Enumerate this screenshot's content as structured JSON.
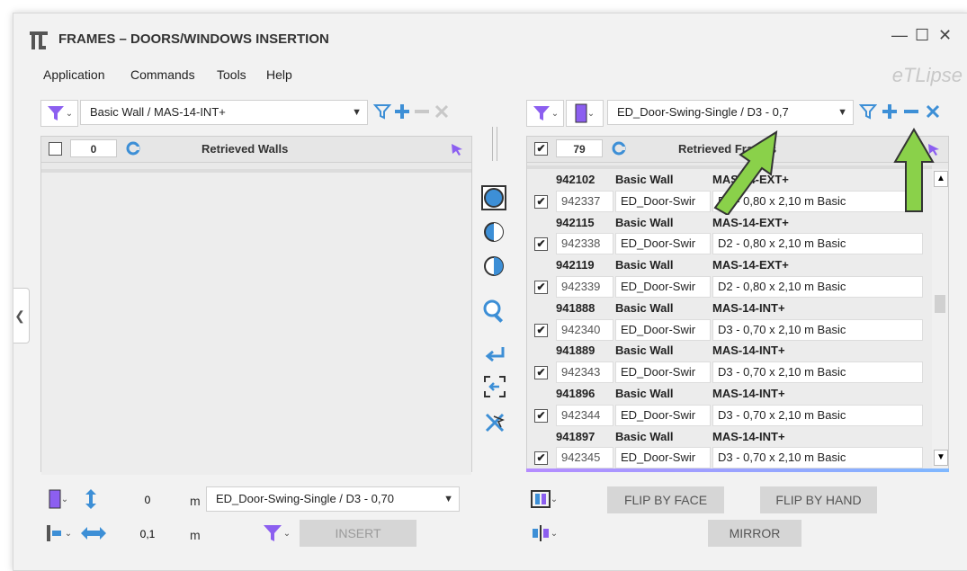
{
  "window": {
    "title": "FRAMES – DOORS/WINDOWS INSERTION",
    "logo": "eTLipse"
  },
  "menu": {
    "items": [
      "Application",
      "Commands",
      "Tools",
      "Help"
    ]
  },
  "left": {
    "filter_combo": "Basic Wall / MAS-14-INT+",
    "count": "0",
    "header": "Retrieved Walls"
  },
  "right": {
    "filter_combo": "ED_Door-Swing-Single / D3 - 0,7",
    "count": "79",
    "header": "Retrieved Frames",
    "rows": [
      {
        "type": "wall",
        "id": "942102",
        "family": "Basic Wall",
        "type_name": "MAS-14-EXT+"
      },
      {
        "type": "door",
        "checked": true,
        "id": "942337",
        "family": "ED_Door-Swir",
        "type_name": "D2 - 0,80 x 2,10 m Basic"
      },
      {
        "type": "wall",
        "id": "942115",
        "family": "Basic Wall",
        "type_name": "MAS-14-EXT+"
      },
      {
        "type": "door",
        "checked": true,
        "id": "942338",
        "family": "ED_Door-Swir",
        "type_name": "D2 - 0,80 x 2,10 m Basic"
      },
      {
        "type": "wall",
        "id": "942119",
        "family": "Basic Wall",
        "type_name": "MAS-14-EXT+"
      },
      {
        "type": "door",
        "checked": true,
        "id": "942339",
        "family": "ED_Door-Swir",
        "type_name": "D2 - 0,80 x 2,10 m Basic"
      },
      {
        "type": "wall",
        "id": "941888",
        "family": "Basic Wall",
        "type_name": "MAS-14-INT+"
      },
      {
        "type": "door",
        "checked": true,
        "id": "942340",
        "family": "ED_Door-Swir",
        "type_name": "D3 - 0,70 x 2,10 m Basic"
      },
      {
        "type": "wall",
        "id": "941889",
        "family": "Basic Wall",
        "type_name": "MAS-14-INT+"
      },
      {
        "type": "door",
        "checked": true,
        "id": "942343",
        "family": "ED_Door-Swir",
        "type_name": "D3 - 0,70 x 2,10 m Basic"
      },
      {
        "type": "wall",
        "id": "941896",
        "family": "Basic Wall",
        "type_name": "MAS-14-INT+"
      },
      {
        "type": "door",
        "checked": true,
        "id": "942344",
        "family": "ED_Door-Swir",
        "type_name": "D3 - 0,70 x 2,10 m Basic"
      },
      {
        "type": "wall",
        "id": "941897",
        "family": "Basic Wall",
        "type_name": "MAS-14-INT+"
      },
      {
        "type": "door",
        "checked": true,
        "id": "942345",
        "family": "ED_Door-Swir",
        "type_name": "D3 - 0,70 x 2,10 m Basic"
      }
    ]
  },
  "bottom_left": {
    "offset_value": "0",
    "offset_unit": "m",
    "type_combo": "ED_Door-Swing-Single / D3 - 0,70",
    "spacing_value": "0,1",
    "spacing_unit": "m",
    "insert_label": "INSERT"
  },
  "bottom_right": {
    "flip_face_label": "FLIP BY FACE",
    "flip_hand_label": "FLIP BY HAND",
    "mirror_label": "MIRROR"
  },
  "colors": {
    "accent_blue": "#3d8fd6",
    "accent_purple": "#8c5ff0",
    "annotation_green": "#8ad14a"
  }
}
